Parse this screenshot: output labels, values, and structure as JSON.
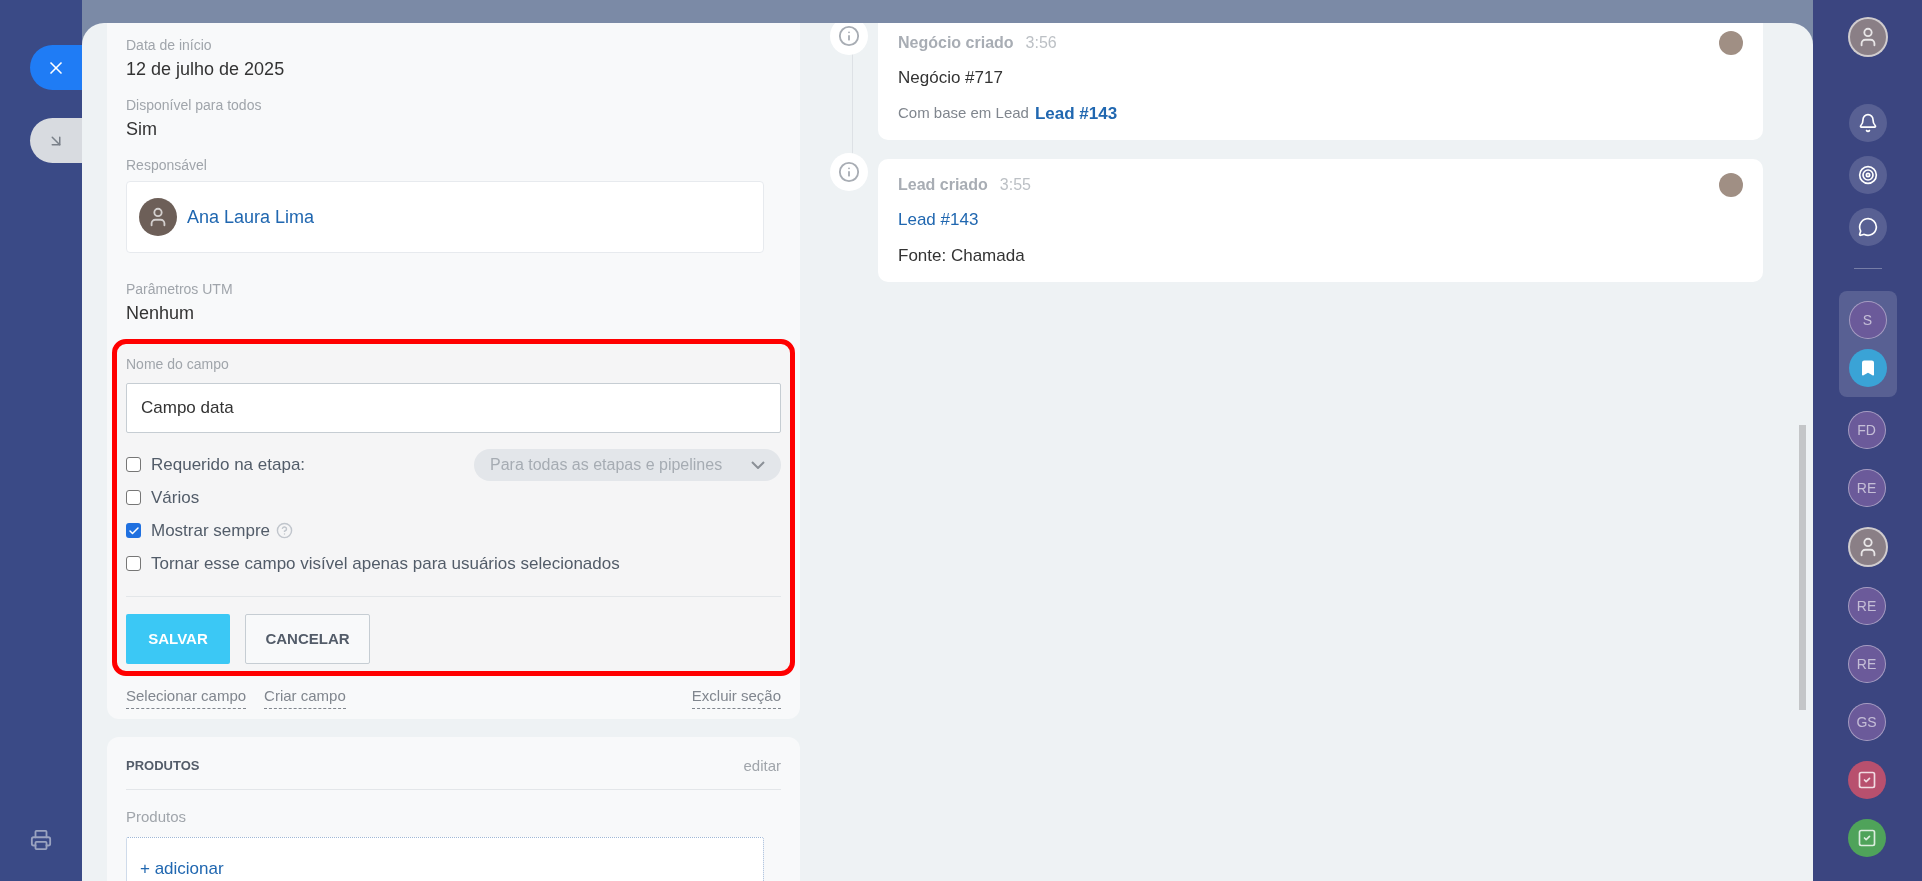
{
  "fields": [
    {
      "kind": "text",
      "label": "Data de início",
      "value": "12 de julho de 2025"
    },
    {
      "kind": "text",
      "label": "Disponível para todos",
      "value": "Sim"
    },
    {
      "kind": "user",
      "label": "Responsável",
      "value": "Ana Laura Lima"
    },
    {
      "kind": "text",
      "label": "Parâmetros UTM",
      "value": "Nenhum"
    }
  ],
  "editor": {
    "label": "Nome do campo",
    "value": "Campo data",
    "options": [
      {
        "label": "Requerido na etapa:",
        "checked": false,
        "help": false,
        "dropdown": "Para todas as etapas e pipelines"
      },
      {
        "label": "Vários",
        "checked": false,
        "help": false
      },
      {
        "label": "Mostrar sempre",
        "checked": true,
        "help": true
      },
      {
        "label": "Tornar esse campo visível apenas para usuários selecionados",
        "checked": false,
        "help": false
      }
    ],
    "buttons": [
      {
        "label": "SALVAR",
        "kind": "primary"
      },
      {
        "label": "CANCELAR",
        "kind": "secondary"
      }
    ]
  },
  "section_links": {
    "left": [
      "Selecionar campo",
      "Criar campo"
    ],
    "right": [
      "Excluir seção"
    ]
  },
  "products": {
    "title": "PRODUTOS",
    "edit": "editar",
    "label": "Produtos",
    "add": "+ adicionar"
  },
  "timeline": [
    {
      "title": "Negócio criado",
      "time": "3:56",
      "lines": [
        {
          "kind": "text",
          "text": "Negócio #717"
        },
        {
          "kind": "based_on",
          "text": "Com base em Lead",
          "link": "Lead #143"
        }
      ]
    },
    {
      "title": "Lead criado",
      "time": "3:55",
      "lines": [
        {
          "kind": "link",
          "text": "Lead #143"
        },
        {
          "kind": "text",
          "text": "Fonte: Chamada"
        }
      ]
    }
  ],
  "sidebar": {
    "top": [
      {
        "kind": "avatar"
      }
    ],
    "tools": [
      {
        "kind": "bell"
      },
      {
        "kind": "target"
      },
      {
        "kind": "chat"
      }
    ],
    "pinned": [
      {
        "kind": "initials",
        "text": "S"
      },
      {
        "kind": "bookmark"
      }
    ],
    "chats": [
      {
        "kind": "initials",
        "text": "FD"
      },
      {
        "kind": "initials",
        "text": "RE"
      },
      {
        "kind": "avatar"
      },
      {
        "kind": "initials",
        "text": "RE"
      },
      {
        "kind": "initials",
        "text": "RE"
      },
      {
        "kind": "initials",
        "text": "GS"
      },
      {
        "kind": "task",
        "color": "#b8506e"
      },
      {
        "kind": "task",
        "color": "#4fa35a"
      }
    ]
  }
}
